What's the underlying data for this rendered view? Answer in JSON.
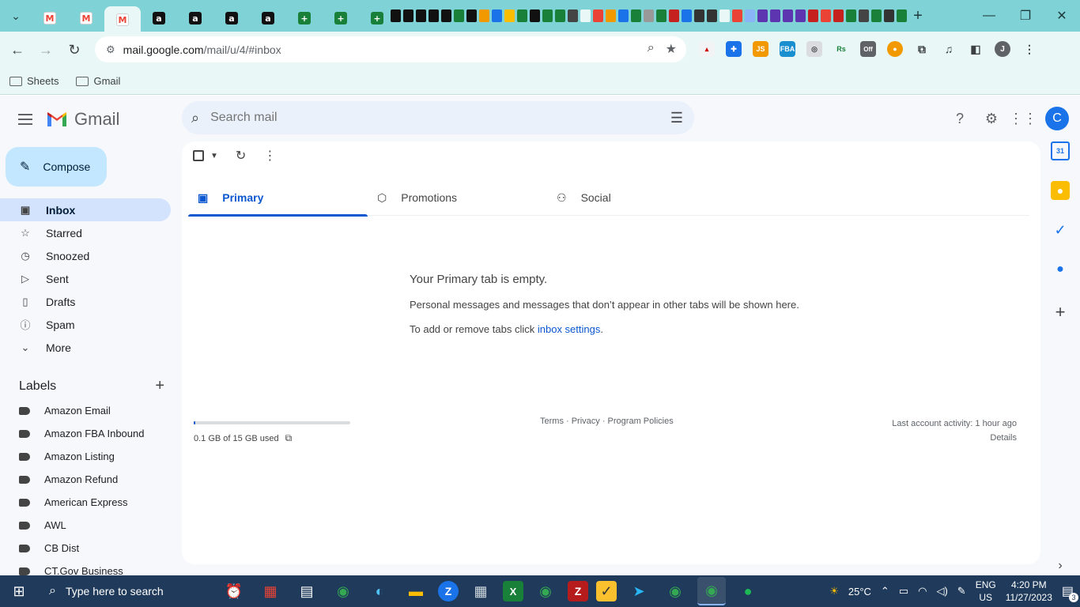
{
  "browser": {
    "tabs": [
      {
        "kind": "gmail"
      },
      {
        "kind": "gmail"
      },
      {
        "kind": "gmail",
        "active": true
      },
      {
        "kind": "amazon"
      },
      {
        "kind": "amazon"
      },
      {
        "kind": "amazon"
      },
      {
        "kind": "amazon"
      },
      {
        "kind": "sheets"
      },
      {
        "kind": "sheets"
      },
      {
        "kind": "sheets"
      }
    ],
    "url_host": "mail.google.com",
    "url_path": "/mail/u/4/#inbox",
    "bookmarks": [
      "Sheets",
      "Gmail"
    ],
    "profile_initial": "J",
    "ext_off_badge": "Off"
  },
  "gmail": {
    "wordmark": "Gmail",
    "search_placeholder": "Search mail",
    "account_initial": "C",
    "compose_label": "Compose",
    "nav": [
      {
        "label": "Inbox",
        "icon": "inbox-icon",
        "glyph": "▣",
        "selected": true
      },
      {
        "label": "Starred",
        "icon": "star-icon",
        "glyph": "☆"
      },
      {
        "label": "Snoozed",
        "icon": "clock-icon",
        "glyph": "◷"
      },
      {
        "label": "Sent",
        "icon": "send-icon",
        "glyph": "▷"
      },
      {
        "label": "Drafts",
        "icon": "draft-icon",
        "glyph": "▯"
      },
      {
        "label": "Spam",
        "icon": "spam-icon",
        "glyph": "ⓘ"
      },
      {
        "label": "More",
        "icon": "chevron-down-icon",
        "glyph": "⌄"
      }
    ],
    "labels_title": "Labels",
    "labels": [
      "Amazon Email",
      "Amazon FBA Inbound",
      "Amazon Listing",
      "Amazon Refund",
      "American Express",
      "AWL",
      "CB Dist",
      "CT.Gov Business"
    ],
    "categories": [
      {
        "label": "Primary",
        "icon": "inbox-tab-icon",
        "glyph": "▣",
        "selected": true
      },
      {
        "label": "Promotions",
        "icon": "tag-icon",
        "glyph": "⬡"
      },
      {
        "label": "Social",
        "icon": "people-icon",
        "glyph": "⚇"
      }
    ],
    "empty_title": "Your Primary tab is empty.",
    "empty_desc": "Personal messages and messages that don’t appear in other tabs will be shown here.",
    "empty_hint_prefix": "To add or remove tabs click ",
    "empty_hint_link": "inbox settings",
    "empty_hint_suffix": ".",
    "storage_text": "0.1 GB of 15 GB used",
    "storage_fraction": 0.007,
    "footer_links": "Terms · Privacy · Program Policies",
    "last_activity": "Last account activity: 1 hour ago",
    "details": "Details"
  },
  "taskbar": {
    "search_placeholder": "Type here to search",
    "weather": "25°C",
    "lang": "ENG",
    "region": "US",
    "time": "4:20 PM",
    "date": "11/27/2023",
    "notif_count": "3"
  },
  "colors": {
    "accent": "#0b57d0",
    "compose_bg": "#c2e7ff",
    "nav_selected": "#d3e3fd",
    "browser_frame": "#7fd3d6"
  }
}
